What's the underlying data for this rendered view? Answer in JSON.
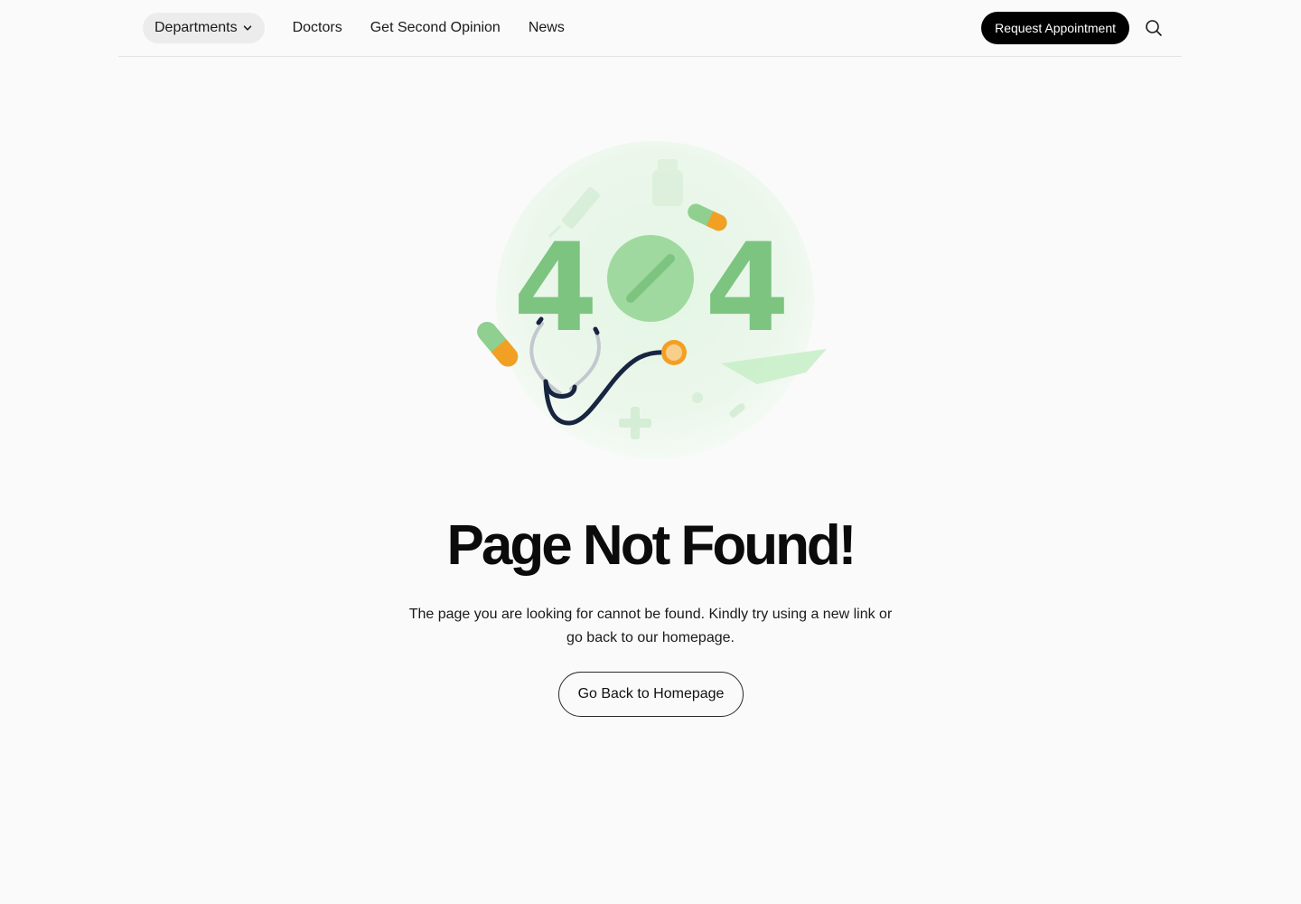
{
  "nav": {
    "departments_label": "Departments",
    "links": [
      "Doctors",
      "Get Second Opinion",
      "News"
    ],
    "request_label": "Request Appointment"
  },
  "hero": {
    "illustration_text": "404",
    "title": "Page Not Found!",
    "description": "The page you are looking for cannot be found. Kindly try using a new link or go back to our homepage.",
    "button_label": "Go Back to Homepage"
  },
  "colors": {
    "accent_green": "#7cc47f",
    "orange": "#f2a024",
    "black": "#000000"
  }
}
